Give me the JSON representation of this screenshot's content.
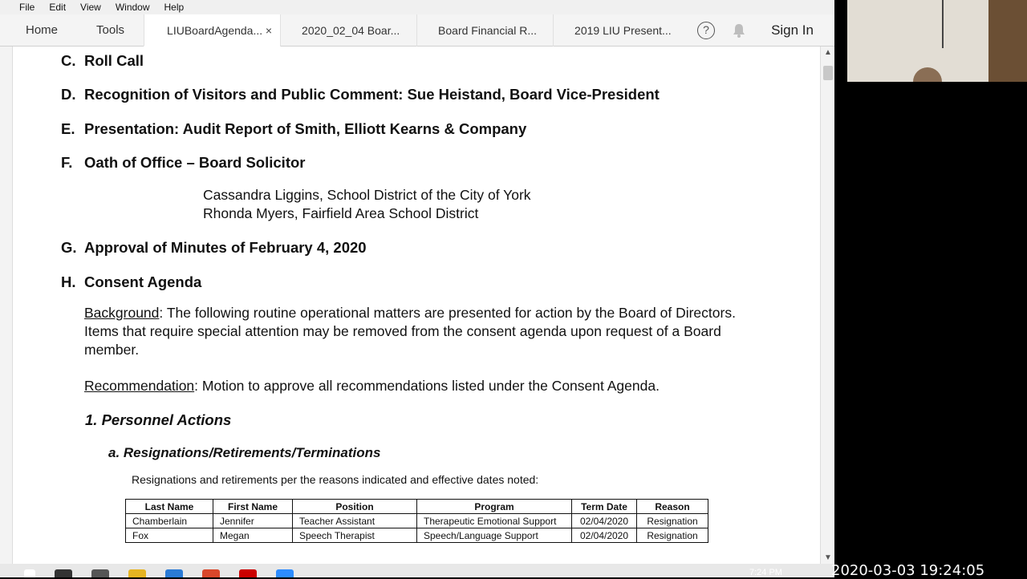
{
  "menu": [
    "File",
    "Edit",
    "View",
    "Window",
    "Help"
  ],
  "nav": {
    "home": "Home",
    "tools": "Tools",
    "sign_in": "Sign In"
  },
  "tabs": [
    {
      "label": "LIUBoardAgenda...",
      "active": true,
      "close": "×"
    },
    {
      "label": "2020_02_04 Boar..."
    },
    {
      "label": "Board Financial R..."
    },
    {
      "label": "2019 LIU Present..."
    }
  ],
  "doc": {
    "c": {
      "letter": "C.",
      "text": "Roll Call"
    },
    "d": {
      "letter": "D.",
      "text": "Recognition of Visitors and Public Comment:  Sue Heistand, Board Vice-President"
    },
    "e": {
      "letter": "E.",
      "text": "Presentation:  Audit Report of Smith, Elliott Kearns & Company"
    },
    "f": {
      "letter": "F.",
      "text": "Oath of Office – Board Solicitor"
    },
    "f_line1": "Cassandra Liggins, School District of the City of York",
    "f_line2": "Rhonda Myers, Fairfield Area School District",
    "g": {
      "letter": "G.",
      "text": "Approval of Minutes of February 4, 2020"
    },
    "h": {
      "letter": "H.",
      "text": "Consent Agenda"
    },
    "background_label": "Background",
    "background_text": ":  The following routine operational matters are presented for action by the Board of Directors.  Items that require special attention may be removed from the consent agenda upon request of a Board member.",
    "recommendation_label": "Recommendation",
    "recommendation_text": ":  Motion to approve all recommendations listed under the Consent Agenda.",
    "section1": "1.  Personnel Actions",
    "section1a": "a.   Resignations/Retirements/Terminations",
    "note": "Resignations and retirements per the reasons indicated and effective dates noted:",
    "table": {
      "headers": [
        "Last Name",
        "First Name",
        "Position",
        "Program",
        "Term Date",
        "Reason"
      ],
      "rows": [
        [
          "Chamberlain",
          "Jennifer",
          "Teacher Assistant",
          "Therapeutic Emotional Support",
          "02/04/2020",
          "Resignation"
        ],
        [
          "Fox",
          "Megan",
          "Speech Therapist",
          "Speech/Language Support",
          "02/04/2020",
          "Resignation"
        ]
      ]
    }
  },
  "overlay": {
    "timestamp": "2020-03-03 19:24:05",
    "clock": "7:24 PM"
  },
  "icons": {
    "help": "?",
    "bell": "bell-icon"
  }
}
